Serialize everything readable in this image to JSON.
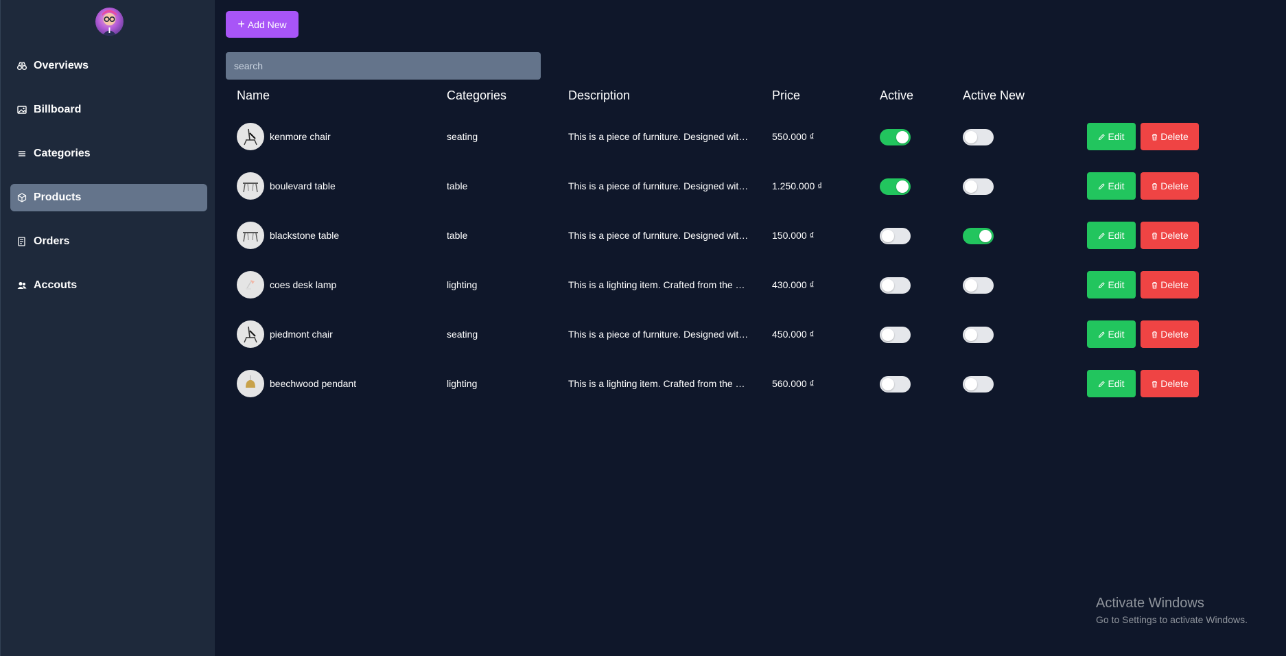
{
  "sidebar": {
    "items": [
      {
        "label": "Overviews",
        "icon": "binoculars-icon"
      },
      {
        "label": "Billboard",
        "icon": "image-icon"
      },
      {
        "label": "Categories",
        "icon": "list-icon"
      },
      {
        "label": "Products",
        "icon": "package-icon",
        "active": true
      },
      {
        "label": "Orders",
        "icon": "receipt-icon"
      },
      {
        "label": "Accouts",
        "icon": "users-icon"
      }
    ]
  },
  "toolbar": {
    "add_label": "Add New",
    "search_placeholder": "search"
  },
  "table": {
    "headers": {
      "name": "Name",
      "categories": "Categories",
      "description": "Description",
      "price": "Price",
      "active": "Active",
      "active_new": "Active New"
    },
    "edit_label": "Edit",
    "delete_label": "Delete",
    "rows": [
      {
        "name": "kenmore chair",
        "category": "seating",
        "description": "This is a piece of furniture. Designed with care and precision",
        "price": "550.000 ₫",
        "active": true,
        "active_new": false,
        "thumb": "chair-icon"
      },
      {
        "name": "boulevard table",
        "category": "table",
        "description": "This is a piece of furniture. Designed with care and precision",
        "price": "1.250.000 ₫",
        "active": true,
        "active_new": false,
        "thumb": "table-icon"
      },
      {
        "name": "blackstone table",
        "category": "table",
        "description": "This is a piece of furniture. Designed with care and precision",
        "price": "150.000 ₫",
        "active": false,
        "active_new": true,
        "thumb": "table-icon"
      },
      {
        "name": "coes desk lamp",
        "category": "lighting",
        "description": "This is a lighting item. Crafted from the highest quality",
        "price": "430.000 ₫",
        "active": false,
        "active_new": false,
        "thumb": "lamp-icon"
      },
      {
        "name": "piedmont chair",
        "category": "seating",
        "description": "This is a piece of furniture. Designed with care and precision",
        "price": "450.000 ₫",
        "active": false,
        "active_new": false,
        "thumb": "chair-icon"
      },
      {
        "name": "beechwood pendant",
        "category": "lighting",
        "description": "This is a lighting item. Crafted from the highest quality",
        "price": "560.000 ₫",
        "active": false,
        "active_new": false,
        "thumb": "pendant-icon"
      }
    ]
  },
  "watermark": {
    "title": "Activate Windows",
    "subtitle": "Go to Settings to activate Windows."
  },
  "colors": {
    "background": "#0f172a",
    "sidebar": "#1e293b",
    "accent": "#a855f7",
    "success": "#22c55e",
    "danger": "#ef4444"
  }
}
